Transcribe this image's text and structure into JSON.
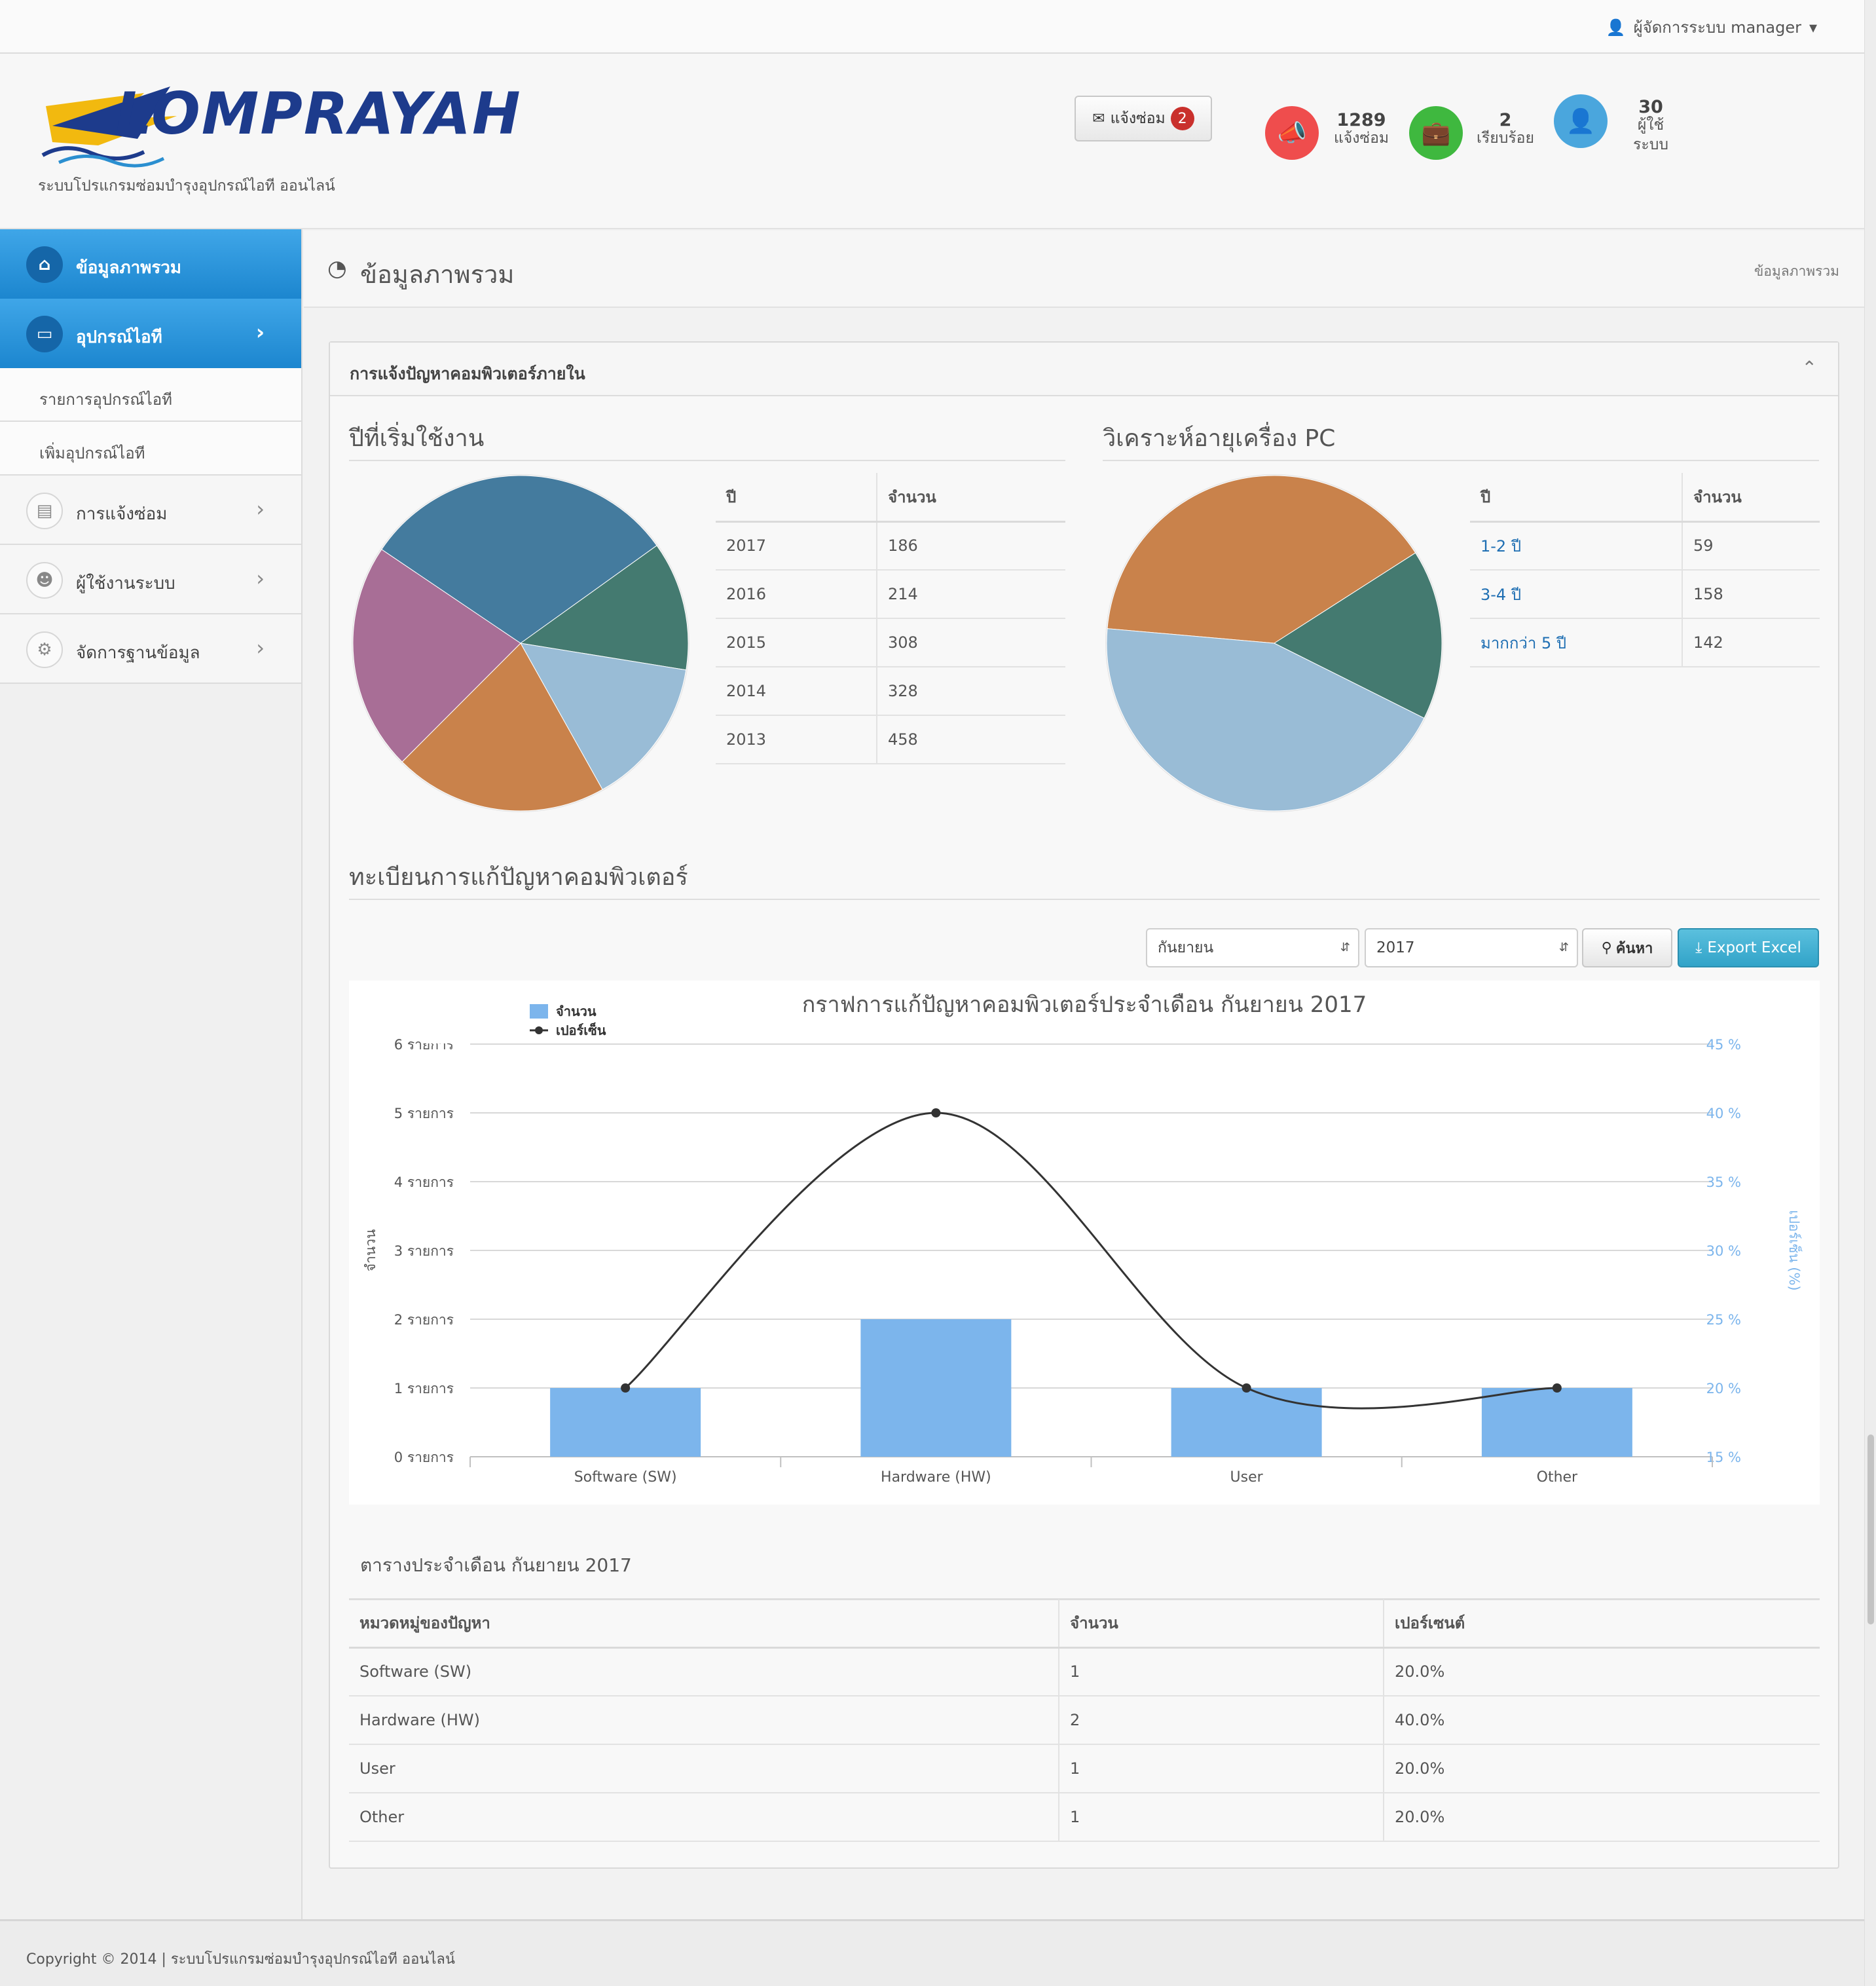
{
  "topbar": {
    "user_label": "ผู้จัดการระบบ manager"
  },
  "header": {
    "logo_text": "LOMPRAYAH",
    "subtitle": "ระบบโปรแกรมซ่อมบำรุงอุปกรณ์ไอที ออนไลน์",
    "repair_button": "แจ้งซ่อม",
    "repair_badge": "2",
    "stats": [
      {
        "value": "1289",
        "label": "แจ้งซ่อม",
        "color": "#ef4d4d",
        "icon": "megaphone-icon"
      },
      {
        "value": "2",
        "label": "เรียบร้อย",
        "color": "#3fb83f",
        "icon": "briefcase-icon"
      },
      {
        "value": "30",
        "label": "ผู้ใช้ ระบบ",
        "label_line1": "ผู้ใช้",
        "label_line2": "ระบบ",
        "color": "#4aa6dd",
        "icon": "user-icon"
      }
    ]
  },
  "sidebar": {
    "items": [
      {
        "label": "ข้อมูลภาพรวม",
        "icon": "home-icon"
      },
      {
        "label": "อุปกรณ์ไอที",
        "icon": "monitor-icon"
      },
      {
        "label": "รายการอุปกรณ์ไอที"
      },
      {
        "label": "เพิ่มอุปกรณ์ไอที"
      },
      {
        "label": "การแจ้งซ่อม",
        "icon": "inbox-icon"
      },
      {
        "label": "ผู้ใช้งานระบบ",
        "icon": "users-icon"
      },
      {
        "label": "จัดการฐานข้อมูล",
        "icon": "cogs-icon"
      }
    ]
  },
  "page": {
    "title": "ข้อมูลภาพรวม",
    "breadcrumb": "ข้อมูลภาพรวม"
  },
  "panel": {
    "title": "การแจ้งปัญหาคอมพิวเตอร์ภายใน"
  },
  "colors": {
    "accent": "#1c86cf",
    "pie": [
      "#447b9e",
      "#447a70",
      "#99bcd6",
      "#c9824b",
      "#a86e96"
    ]
  },
  "section_years": {
    "title": "ปีที่เริ่มใช้งาน",
    "headers": [
      "ปี",
      "จำนวน"
    ],
    "rows": [
      {
        "year": "2017",
        "count": "186"
      },
      {
        "year": "2016",
        "count": "214"
      },
      {
        "year": "2015",
        "count": "308"
      },
      {
        "year": "2014",
        "count": "328"
      },
      {
        "year": "2013",
        "count": "458"
      }
    ]
  },
  "section_age": {
    "title": "วิเคราะห์อายุเครื่อง PC",
    "headers": [
      "ปี",
      "จำนวน"
    ],
    "rows": [
      {
        "label": "1-2 ปี",
        "count": "59"
      },
      {
        "label": "3-4 ปี",
        "count": "158"
      },
      {
        "label": "มากกว่า 5 ปี",
        "count": "142"
      }
    ]
  },
  "section_repair": {
    "title": "ทะเบียนการแก้ปัญหาคอมพิวเตอร์",
    "month_select": "กันยายน",
    "year_select": "2017",
    "search_label": "ค้นหา",
    "export_label": "Export Excel",
    "table_title": "ตารางประจำเดือน กันยายน 2017",
    "headers": [
      "หมวดหมู่ของปัญหา",
      "จำนวน",
      "เปอร์เซนต์"
    ],
    "rows": [
      {
        "category": "Software (SW)",
        "count": "1",
        "percent": "20.0%"
      },
      {
        "category": "Hardware (HW)",
        "count": "2",
        "percent": "40.0%"
      },
      {
        "category": "User",
        "count": "1",
        "percent": "20.0%"
      },
      {
        "category": "Other",
        "count": "1",
        "percent": "20.0%"
      }
    ]
  },
  "chart_data": [
    {
      "type": "pie",
      "title": "ปีที่เริ่มใช้งาน",
      "labels": [
        "2013",
        "2017",
        "2016",
        "2015",
        "2014"
      ],
      "values": [
        458,
        186,
        214,
        308,
        328
      ],
      "colors": [
        "#447b9e",
        "#447a70",
        "#99bcd6",
        "#c9824b",
        "#a86e96"
      ]
    },
    {
      "type": "pie",
      "title": "วิเคราะห์อายุเครื่อง PC",
      "labels": [
        "มากกว่า 5 ปี",
        "1-2 ปี",
        "3-4 ปี"
      ],
      "values": [
        142,
        59,
        158
      ],
      "colors": [
        "#c9824b",
        "#447a70",
        "#99bcd6"
      ]
    },
    {
      "type": "bar",
      "title": "กราฟการแก้ปัญหาคอมพิวเตอร์ประจำเดือน กันยายน 2017",
      "categories": [
        "Software (SW)",
        "Hardware (HW)",
        "User",
        "Other"
      ],
      "series": [
        {
          "name": "จำนวน",
          "type": "bar",
          "values": [
            1,
            2,
            1,
            1
          ],
          "color": "#7cb5ec"
        },
        {
          "name": "เปอร์เซ็น",
          "type": "line",
          "values": [
            20,
            40,
            20,
            20
          ],
          "color": "#333333"
        }
      ],
      "ylabel": "จำนวน",
      "ylabel_right": "เปอร์เซ็น (%)",
      "ylim": [
        0,
        6
      ],
      "ylim_right": [
        15,
        45
      ],
      "y_ticks": [
        "0 รายการ",
        "1 รายการ",
        "2 รายการ",
        "3 รายการ",
        "4 รายการ",
        "5 รายการ",
        "6 รายการ"
      ],
      "y_right_ticks": [
        "15 %",
        "20 %",
        "25 %",
        "30 %",
        "35 %",
        "40 %",
        "45 %"
      ],
      "legend": "top-left",
      "grid": true
    }
  ],
  "footer": {
    "text": "Copyright © 2014 | ระบบโปรแกรมซ่อมบำรุงอุปกรณ์ไอที ออนไลน์"
  }
}
